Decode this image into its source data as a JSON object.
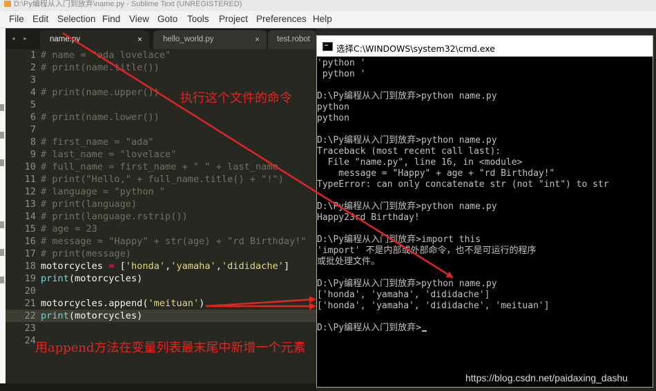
{
  "window_title": "D:\\Py编程从入门到放弃\\name.py - Sublime Text (UNREGISTERED)",
  "menu": [
    "File",
    "Edit",
    "Selection",
    "Find",
    "View",
    "Goto",
    "Tools",
    "Project",
    "Preferences",
    "Help"
  ],
  "tabs": [
    {
      "label": "name.py",
      "close": "×",
      "active": true
    },
    {
      "label": "hello_world.py",
      "close": "×",
      "active": false
    },
    {
      "label": "test.robot",
      "close": "",
      "active": false
    }
  ],
  "nav_arrows": "◂ ▸",
  "line_numbers": [
    "1",
    "2",
    "3",
    "4",
    "5",
    "6",
    "7",
    "8",
    "9",
    "10",
    "11",
    "12",
    "13",
    "14",
    "15",
    "16",
    "17",
    "18",
    "19",
    "20",
    "21",
    "22",
    "23",
    "24"
  ],
  "code_lines": [
    [
      {
        "t": "# name = \"ada lovelace\"",
        "c": "com"
      }
    ],
    [
      {
        "t": "# print(name.title())",
        "c": "com"
      }
    ],
    [],
    [
      {
        "t": "# print(name.upper())",
        "c": "com"
      }
    ],
    [],
    [
      {
        "t": "# print(name.lower())",
        "c": "com"
      }
    ],
    [],
    [
      {
        "t": "# first_name = \"ada\"",
        "c": "com"
      }
    ],
    [
      {
        "t": "# last_name = \"lovelace\"",
        "c": "com"
      }
    ],
    [
      {
        "t": "# full_name = first_name + \" \" + last_name",
        "c": "com"
      }
    ],
    [
      {
        "t": "# print(\"Hello,\" + full_name.title() + \"!\")",
        "c": "com"
      }
    ],
    [
      {
        "t": "# language = \"python \"",
        "c": "com"
      }
    ],
    [
      {
        "t": "# print(language)",
        "c": "com"
      }
    ],
    [
      {
        "t": "# print(language.rstrip())",
        "c": "com"
      }
    ],
    [
      {
        "t": "# age = 23",
        "c": "com"
      }
    ],
    [
      {
        "t": "# message = \"Happy\" + str(age) + \"rd Birthday!\"",
        "c": "com"
      }
    ],
    [
      {
        "t": "# print(message)",
        "c": "com"
      }
    ],
    [
      {
        "t": "motorcycles ",
        "c": "txt"
      },
      {
        "t": "=",
        "c": "op"
      },
      {
        "t": " [",
        "c": "txt"
      },
      {
        "t": "'honda'",
        "c": "str"
      },
      {
        "t": ",",
        "c": "txt"
      },
      {
        "t": "'yamaha'",
        "c": "str"
      },
      {
        "t": ",",
        "c": "txt"
      },
      {
        "t": "'dididache'",
        "c": "str"
      },
      {
        "t": "]",
        "c": "txt"
      }
    ],
    [
      {
        "t": "print",
        "c": "fn"
      },
      {
        "t": "(motorcycles)",
        "c": "txt"
      }
    ],
    [],
    [
      {
        "t": "motorcycles.append(",
        "c": "txt"
      },
      {
        "t": "'meituan'",
        "c": "str"
      },
      {
        "t": ")",
        "c": "txt"
      }
    ],
    [
      {
        "t": "print",
        "c": "fn"
      },
      {
        "t": "(motorcycles)",
        "c": "txt"
      }
    ],
    [],
    []
  ],
  "highlighted_line": 22,
  "cmd": {
    "title": "选择C:\\WINDOWS\\system32\\cmd.exe",
    "lines": [
      "'python '",
      " python '",
      "",
      "D:\\Py编程从入门到放弃>python name.py",
      "python",
      "python",
      "",
      "D:\\Py编程从入门到放弃>python name.py",
      "Traceback (most recent call last):",
      "  File \"name.py\", line 16, in <module>",
      "    message = \"Happy\" + age + \"rd Birthday!\"",
      "TypeError: can only concatenate str (not \"int\") to str",
      "",
      "D:\\Py编程从入门到放弃>python name.py",
      "Happy23rd Birthday!",
      "",
      "D:\\Py编程从入门到放弃>import this",
      "'import' 不是内部或外部命令，也不是可运行的程序",
      "或批处理文件。",
      "",
      "D:\\Py编程从入门到放弃>python name.py",
      "['honda', 'yamaha', 'dididache']",
      "['honda', 'yamaha', 'dididache', 'meituan']",
      "",
      "D:\\Py编程从入门到放弃>"
    ]
  },
  "annotations": {
    "run_command": "执行这个文件的命令",
    "append_note": "用append方法在变量列表最末尾中新增一个元素"
  },
  "watermark": "https://blog.csdn.net/paidaxing_dashu",
  "colors": {
    "editor_bg": "#272822",
    "comment": "#75715e",
    "string": "#e6db74",
    "keyword": "#f92672",
    "function": "#66d9ef",
    "annotation_red": "#e0261f"
  }
}
